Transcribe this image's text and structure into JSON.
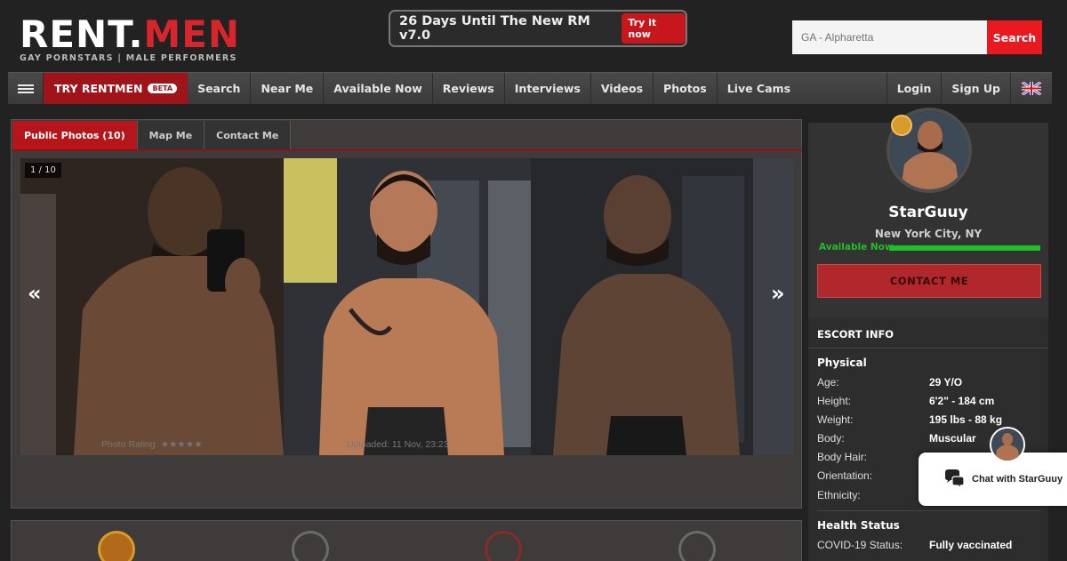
{
  "logo": {
    "part1": "RENT.",
    "part2": "MEN",
    "tagline": "GAY PORNSTARS | MALE PERFORMERS"
  },
  "promo": {
    "text": "26 Days Until The New RM v7.0",
    "button": "Try it now"
  },
  "search": {
    "placeholder": "GA - Alpharetta",
    "button": "Search"
  },
  "nav": {
    "try_label": "TRY RENTMEN",
    "beta": "BETA",
    "items": [
      "Search",
      "Near Me",
      "Available Now",
      "Reviews",
      "Interviews",
      "Videos",
      "Photos",
      "Live Cams"
    ],
    "login": "Login",
    "signup": "Sign Up"
  },
  "gallery": {
    "tabs": [
      "Public Photos (10)",
      "Map Me",
      "Contact Me"
    ],
    "counter": "1 / 10",
    "prev": "«",
    "next": "»",
    "rating_label": "Photo Rating:",
    "stars": "★★★★★",
    "uploaded": "Uploaded: 11 Nov, 23:23"
  },
  "profile": {
    "name": "StarGuuy",
    "city": "New York City, NY",
    "availability": "Available Now",
    "contact_button": "CONTACT ME"
  },
  "escort_info": {
    "heading": "ESCORT INFO",
    "physical_heading": "Physical",
    "rows": [
      {
        "label": "Age:",
        "value": "29 Y/O"
      },
      {
        "label": "Height:",
        "value": "6'2\" - 184 cm"
      },
      {
        "label": "Weight:",
        "value": "195 lbs - 88 kg"
      },
      {
        "label": "Body:",
        "value": "Muscular"
      },
      {
        "label": "Body Hair:",
        "value": ""
      },
      {
        "label": "Orientation:",
        "value": ""
      },
      {
        "label": "Ethnicity:",
        "value": ""
      }
    ],
    "health_heading": "Health Status",
    "covid_label": "COVID-19 Status:",
    "covid_value": "Fully vaccinated"
  },
  "chat": {
    "label": "Chat with StarGuuy"
  },
  "colors": {
    "brand_red": "#d7262b",
    "available_green": "#1fbf2a"
  }
}
